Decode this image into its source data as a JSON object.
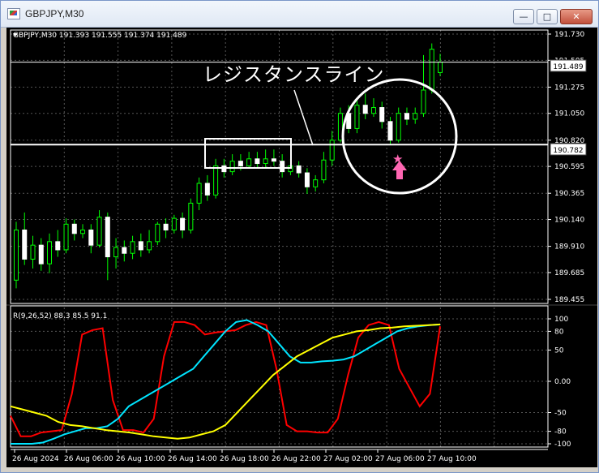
{
  "window": {
    "title": "GBPJPY,M30",
    "min_label": "—",
    "max_label": "□",
    "close_label": "✕"
  },
  "chart_data": [
    {
      "type": "candlestick",
      "info": "GBPJPY,M30  191.393 191.555 191.374 191.489",
      "y_ticks": [
        "191.730",
        "191.505",
        "191.275",
        "191.050",
        "190.820",
        "190.595",
        "190.365",
        "190.140",
        "189.910",
        "189.685",
        "189.455"
      ],
      "ylim": [
        189.455,
        191.73
      ],
      "grid": true,
      "current_price": "191.489",
      "horizontal_line": "190.782",
      "annotation": "レジスタンスライン",
      "candles": [
        [
          189.62,
          190.05,
          189.55,
          190.12
        ],
        [
          190.05,
          189.8,
          189.75,
          190.2
        ],
        [
          189.8,
          189.92,
          189.72,
          190.0
        ],
        [
          189.92,
          189.76,
          189.7,
          189.98
        ],
        [
          189.76,
          189.95,
          189.68,
          190.02
        ],
        [
          189.95,
          189.88,
          189.82,
          190.05
        ],
        [
          189.88,
          190.1,
          189.85,
          190.15
        ],
        [
          190.1,
          190.02,
          189.96,
          190.14
        ],
        [
          190.02,
          190.05,
          189.98,
          190.1
        ],
        [
          190.05,
          189.92,
          189.85,
          190.1
        ],
        [
          189.92,
          190.16,
          189.9,
          190.22
        ],
        [
          190.16,
          189.82,
          189.62,
          190.2
        ],
        [
          189.82,
          189.9,
          189.72,
          189.98
        ],
        [
          189.9,
          189.85,
          189.78,
          189.96
        ],
        [
          189.85,
          189.95,
          189.8,
          190.0
        ],
        [
          189.95,
          189.88,
          189.82,
          190.02
        ],
        [
          189.88,
          189.95,
          189.85,
          190.05
        ],
        [
          189.95,
          190.1,
          189.92,
          190.12
        ],
        [
          190.1,
          190.05,
          189.98,
          190.15
        ],
        [
          190.05,
          190.15,
          190.02,
          190.18
        ],
        [
          190.15,
          190.05,
          189.98,
          190.2
        ],
        [
          190.05,
          190.28,
          190.02,
          190.32
        ],
        [
          190.28,
          190.45,
          190.22,
          190.5
        ],
        [
          190.45,
          190.35,
          190.3,
          190.52
        ],
        [
          190.35,
          190.6,
          190.32,
          190.66
        ],
        [
          190.6,
          190.55,
          190.5,
          190.66
        ],
        [
          190.55,
          190.64,
          190.52,
          190.7
        ],
        [
          190.64,
          190.6,
          190.56,
          190.7
        ],
        [
          190.6,
          190.66,
          190.58,
          190.72
        ],
        [
          190.66,
          190.62,
          190.58,
          190.72
        ],
        [
          190.62,
          190.66,
          190.58,
          190.74
        ],
        [
          190.66,
          190.64,
          190.6,
          190.74
        ],
        [
          190.64,
          190.55,
          190.5,
          190.7
        ],
        [
          190.55,
          190.6,
          190.52,
          190.66
        ],
        [
          190.6,
          190.54,
          190.5,
          190.64
        ],
        [
          190.54,
          190.42,
          190.36,
          190.58
        ],
        [
          190.42,
          190.48,
          190.38,
          190.52
        ],
        [
          190.48,
          190.65,
          190.45,
          190.72
        ],
        [
          190.65,
          190.82,
          190.6,
          190.9
        ],
        [
          190.82,
          191.05,
          190.8,
          191.1
        ],
        [
          191.05,
          190.92,
          190.88,
          191.12
        ],
        [
          190.92,
          191.12,
          190.88,
          191.18
        ],
        [
          191.12,
          191.05,
          191.0,
          191.22
        ],
        [
          191.05,
          191.1,
          191.02,
          191.18
        ],
        [
          191.1,
          190.98,
          190.92,
          191.15
        ],
        [
          190.98,
          190.82,
          190.78,
          191.02
        ],
        [
          190.82,
          191.05,
          190.8,
          191.1
        ],
        [
          191.05,
          191.0,
          190.95,
          191.1
        ],
        [
          191.0,
          191.05,
          190.96,
          191.1
        ],
        [
          191.05,
          191.25,
          191.02,
          191.55
        ],
        [
          191.25,
          191.6,
          191.22,
          191.65
        ],
        [
          191.4,
          191.49,
          191.37,
          191.56
        ]
      ]
    },
    {
      "type": "line",
      "info": "R(9,26,52) 88.3 85.5 91.1",
      "y_ticks": [
        "100",
        "80",
        "50",
        "0.00",
        "-50",
        "-80",
        "-100"
      ],
      "ylim": [
        -100,
        100
      ],
      "x_ticks": [
        "26 Aug 2024",
        "26 Aug 06:00",
        "26 Aug 10:00",
        "26 Aug 14:00",
        "26 Aug 18:00",
        "26 Aug 22:00",
        "27 Aug 02:00",
        "27 Aug 06:00",
        "27 Aug 10:00"
      ],
      "series": [
        {
          "color": "#ff0000",
          "values": [
            -55,
            -88,
            -88,
            -82,
            -80,
            -78,
            -20,
            75,
            82,
            85,
            -30,
            -78,
            -78,
            -82,
            -60,
            40,
            95,
            95,
            90,
            75,
            78,
            80,
            82,
            90,
            95,
            90,
            20,
            -70,
            -80,
            -80,
            -82,
            -82,
            -60,
            10,
            70,
            90,
            95,
            90,
            20,
            -10,
            -40,
            -20,
            88
          ]
        },
        {
          "color": "#00e5ff",
          "values": [
            -100,
            -100,
            -100,
            -98,
            -92,
            -85,
            -80,
            -75,
            -75,
            -72,
            -60,
            -40,
            -30,
            -20,
            -10,
            0,
            10,
            20,
            40,
            60,
            80,
            95,
            98,
            90,
            80,
            60,
            40,
            30,
            30,
            32,
            33,
            35,
            40,
            50,
            60,
            70,
            80,
            85,
            88,
            90,
            91
          ]
        },
        {
          "color": "#ffff00",
          "values": [
            -40,
            -45,
            -50,
            -55,
            -65,
            -70,
            -72,
            -75,
            -78,
            -80,
            -82,
            -85,
            -88,
            -90,
            -92,
            -90,
            -85,
            -80,
            -70,
            -50,
            -30,
            -10,
            10,
            25,
            40,
            50,
            60,
            70,
            75,
            80,
            82,
            85,
            86,
            88,
            89,
            90,
            91
          ]
        }
      ]
    }
  ]
}
